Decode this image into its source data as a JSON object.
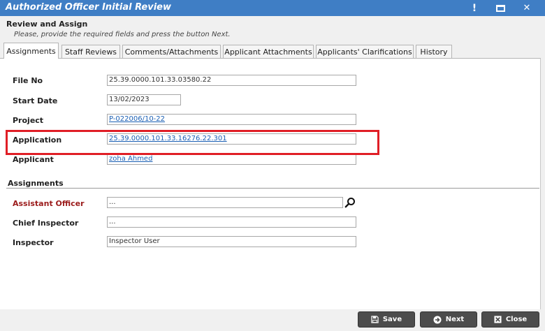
{
  "window": {
    "title": "Authorized Officer Initial Review",
    "controls": {
      "alert": "!",
      "close": "✕"
    }
  },
  "header": {
    "section_title": "Review and Assign",
    "instruction": "Please, provide the required fields and press the button Next."
  },
  "tabs": [
    {
      "label": "Assignments",
      "active": true
    },
    {
      "label": "Staff Reviews"
    },
    {
      "label": "Comments/Attachments"
    },
    {
      "label": "Applicant Attachments"
    },
    {
      "label": "Applicants' Clarifications"
    },
    {
      "label": "History"
    }
  ],
  "details": {
    "file_no": {
      "label": "File No",
      "value": "25.39.0000.101.33.03580.22"
    },
    "start_date": {
      "label": "Start Date",
      "value": "13/02/2023"
    },
    "project": {
      "label": "Project",
      "value": "P-022006/10-22"
    },
    "application": {
      "label": "Application",
      "value": "25.39.0000.101.33.16276.22.301"
    },
    "applicant": {
      "label": "Applicant",
      "value": "zoha Ahmed"
    }
  },
  "assignments": {
    "title": "Assignments",
    "assistant_officer": {
      "label": "Assistant Officer",
      "value": "..."
    },
    "chief_inspector": {
      "label": "Chief Inspector",
      "value": "..."
    },
    "inspector": {
      "label": "Inspector",
      "value": "Inspector User"
    }
  },
  "buttons": {
    "save": "Save",
    "next": "Next",
    "close": "Close"
  },
  "colors": {
    "titlebar": "#3f7ec5",
    "highlight": "#e01e26",
    "required_label": "#9b1b1b",
    "button": "#4c4c4c",
    "link": "#1a5fb4"
  },
  "icons": {
    "alert": "alert-icon",
    "maximize": "maximize-icon",
    "close": "close-icon",
    "search": "search-icon",
    "save": "save-icon",
    "next": "arrow-right-circle-icon",
    "close_button": "close-box-icon"
  }
}
